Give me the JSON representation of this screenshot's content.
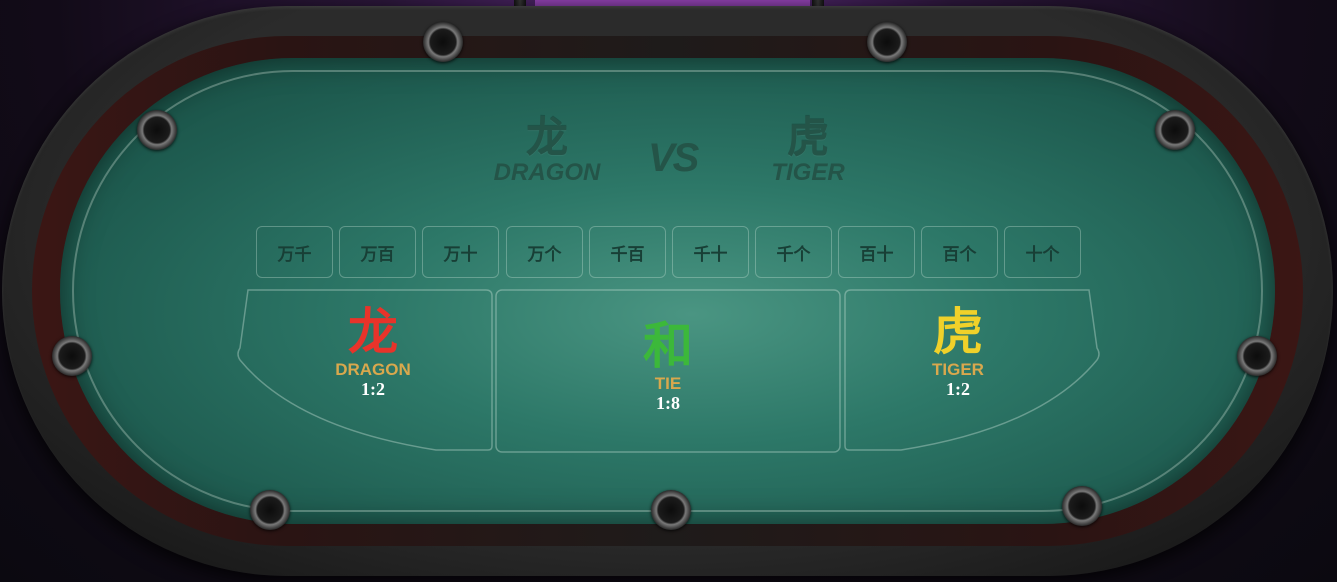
{
  "header": {
    "dragon_cn": "龙",
    "dragon_en": "DRAGON",
    "vs": "VS",
    "tiger_cn": "虎",
    "tiger_en": "TIGER"
  },
  "digit_bets": [
    "万千",
    "万百",
    "万十",
    "万个",
    "千百",
    "千十",
    "千个",
    "百十",
    "百个",
    "十个"
  ],
  "zones": {
    "dragon": {
      "cn": "龙",
      "en": "DRAGON",
      "odds": "1:2",
      "color": "#e8332a"
    },
    "tie": {
      "cn": "和",
      "en": "TIE",
      "odds": "1:8",
      "color": "#3cb83a"
    },
    "tiger": {
      "cn": "虎",
      "en": "TIGER",
      "odds": "1:2",
      "color": "#f0d12a"
    }
  },
  "colors": {
    "felt": "#2d7868",
    "label_gold": "#d9a84d",
    "watermark": "#245448"
  }
}
